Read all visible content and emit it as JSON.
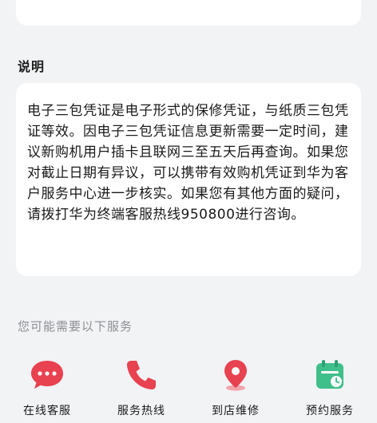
{
  "section": {
    "title": "说明"
  },
  "description": {
    "text": "电子三包凭证是电子形式的保修凭证，与纸质三包凭证等效。因电子三包凭证信息更新需要一定时间，建议新购机用户插卡且联网三至五天后再查询。如果您对截止日期有异议，可以携带有效购机凭证到华为客户服务中心进一步核实。如果您有其他方面的疑问，请拨打华为终端客服热线950800进行咨询。"
  },
  "services": {
    "title": "您可能需要以下服务",
    "items": [
      {
        "label": "在线客服",
        "icon": "chat-bubble-icon",
        "color": "#e8414f"
      },
      {
        "label": "服务热线",
        "icon": "phone-icon",
        "color": "#e8414f"
      },
      {
        "label": "到店维修",
        "icon": "location-pin-icon",
        "color": "#e8414f"
      },
      {
        "label": "预约服务",
        "icon": "calendar-icon",
        "color": "#3fbf8a"
      }
    ]
  }
}
